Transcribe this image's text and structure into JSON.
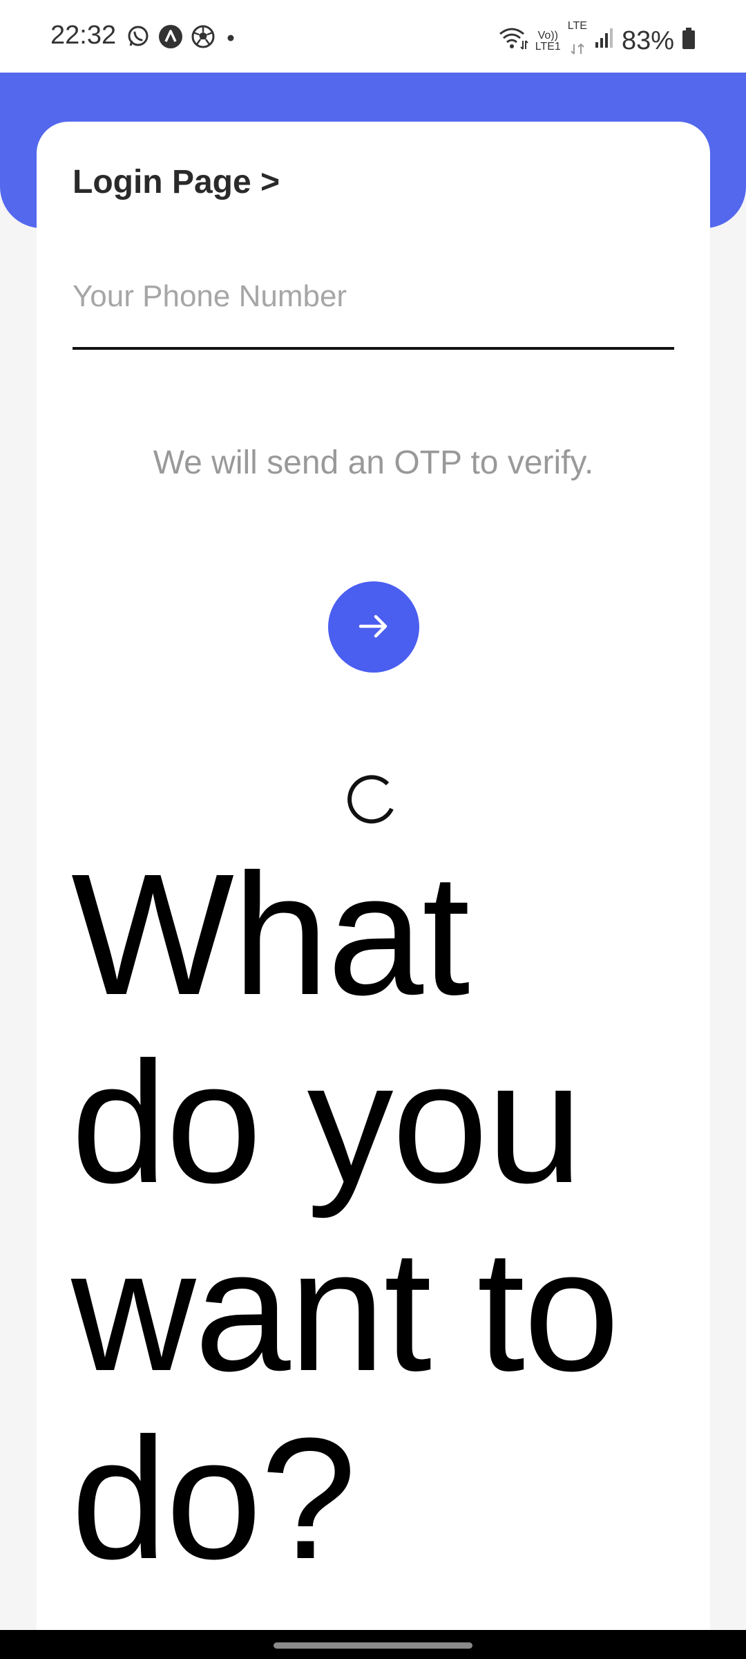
{
  "status_bar": {
    "time": "22:32",
    "left_icons": [
      "whatsapp-icon",
      "app-a-icon",
      "football-icon",
      "dot-icon"
    ],
    "volte_label": "Vo))",
    "lte1_label": "LTE1",
    "lte_label": "LTE",
    "battery": "83%"
  },
  "login": {
    "title": "Login Page >",
    "phone_placeholder": "Your Phone Number",
    "otp_note": "We will send an OTP to verify."
  },
  "question": {
    "text": "What do you want to do?"
  },
  "colors": {
    "accent": "#5468ee",
    "button": "#4a5ef0"
  }
}
